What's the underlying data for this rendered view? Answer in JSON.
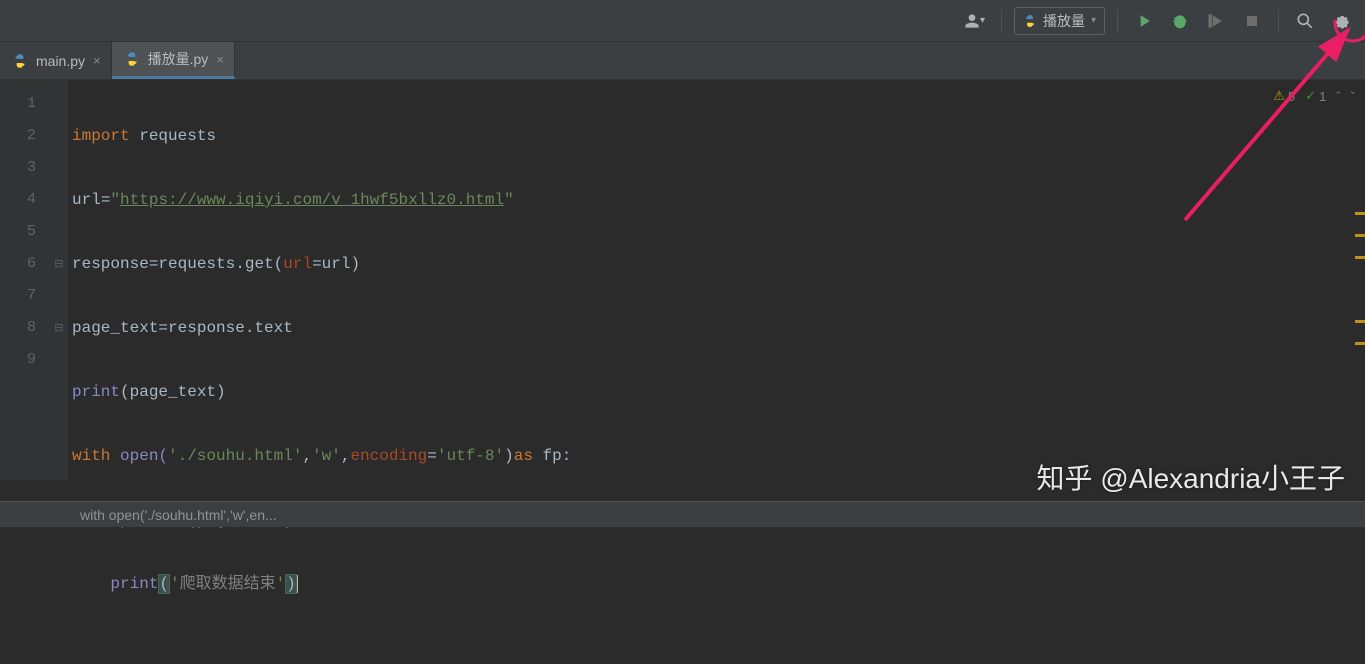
{
  "toolbar": {
    "run_config_label": "播放量"
  },
  "tabs": [
    {
      "name": "main.py",
      "active": false
    },
    {
      "name": "播放量.py",
      "active": true
    }
  ],
  "gutter_lines": [
    "1",
    "2",
    "3",
    "4",
    "5",
    "6",
    "7",
    "8",
    "9"
  ],
  "code": {
    "l1": {
      "kw": "import",
      "ident": " requests"
    },
    "l2": {
      "lhs": "url",
      "op": "=",
      "q": "\"",
      "link": "https://www.iqiyi.com/v_1hwf5bxllz0.html"
    },
    "l3": {
      "lhs": "response",
      "op": "=",
      "call": "requests.get(",
      "param": "url",
      "eq": "=",
      "arg": "url",
      "close": ")"
    },
    "l4": {
      "lhs": "page_text",
      "op": "=",
      "rhs": "response.text"
    },
    "l5": {
      "fn": "print",
      "open": "(",
      "arg": "page_text",
      "close": ")"
    },
    "l6": {
      "kw": "with",
      "fn": " open(",
      "s1": "'./souhu.html'",
      "c": ",",
      "s2": "'w'",
      "c2": ",",
      "param": "encoding",
      "eq": "=",
      "s3": "'utf-8'",
      "close": ")",
      "kwas": "as ",
      "ident": "fp:"
    },
    "l7": {
      "indent": "    ",
      "call": "fp.write(page_text)"
    },
    "l8": {
      "indent": "    ",
      "fn": "print",
      "open": "(",
      "q1": "'",
      "cn": "爬取数据结束",
      "q2": "'",
      "close": ")"
    }
  },
  "inspection": {
    "warnings": "5",
    "checks": "1"
  },
  "status_bar": {
    "breadcrumb": "with open('./souhu.html','w',en..."
  },
  "watermark": "知乎 @Alexandria小王子"
}
